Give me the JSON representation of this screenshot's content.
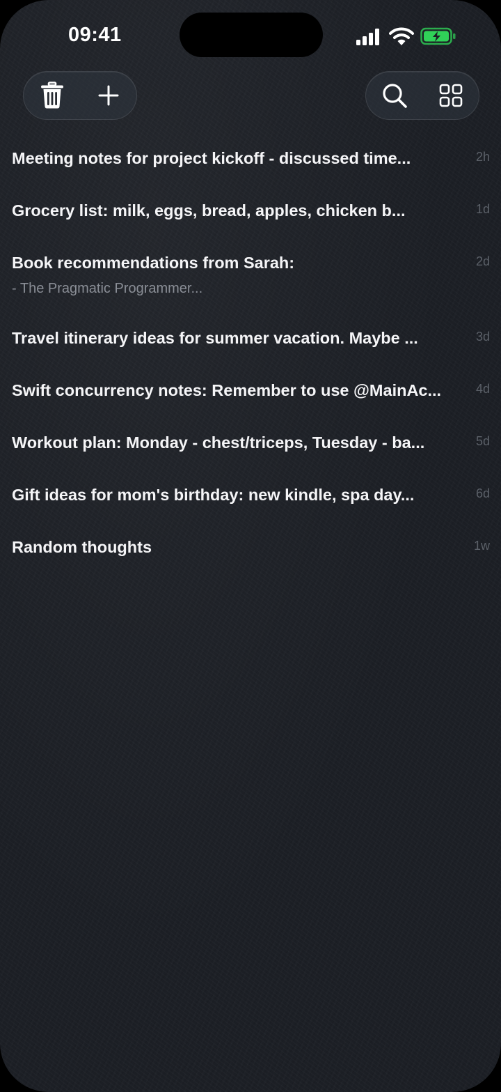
{
  "status_bar": {
    "time": "09:41",
    "icons": [
      "signal-icon",
      "wifi-icon",
      "battery-charging-icon"
    ],
    "battery_color": "#30d158"
  },
  "toolbar": {
    "left_buttons": [
      "trash-icon",
      "plus-icon"
    ],
    "right_buttons": [
      "search-icon",
      "grid-icon"
    ]
  },
  "notes": [
    {
      "title": "Meeting notes for project kickoff - discussed time...",
      "subtitle": "",
      "time": "2h"
    },
    {
      "title": "Grocery list: milk, eggs, bread, apples, chicken b...",
      "subtitle": "",
      "time": "1d"
    },
    {
      "title": "Book recommendations from Sarah:",
      "subtitle": "- The Pragmatic Programmer...",
      "time": "2d"
    },
    {
      "title": "Travel itinerary ideas for summer vacation. Maybe ...",
      "subtitle": "",
      "time": "3d"
    },
    {
      "title": "Swift concurrency notes: Remember to use @MainAc...",
      "subtitle": "",
      "time": "4d"
    },
    {
      "title": "Workout plan: Monday - chest/triceps, Tuesday - ba...",
      "subtitle": "",
      "time": "5d"
    },
    {
      "title": "Gift ideas for mom's birthday: new kindle, spa day...",
      "subtitle": "",
      "time": "6d"
    },
    {
      "title": "Random thoughts",
      "subtitle": "",
      "time": "1w"
    }
  ]
}
